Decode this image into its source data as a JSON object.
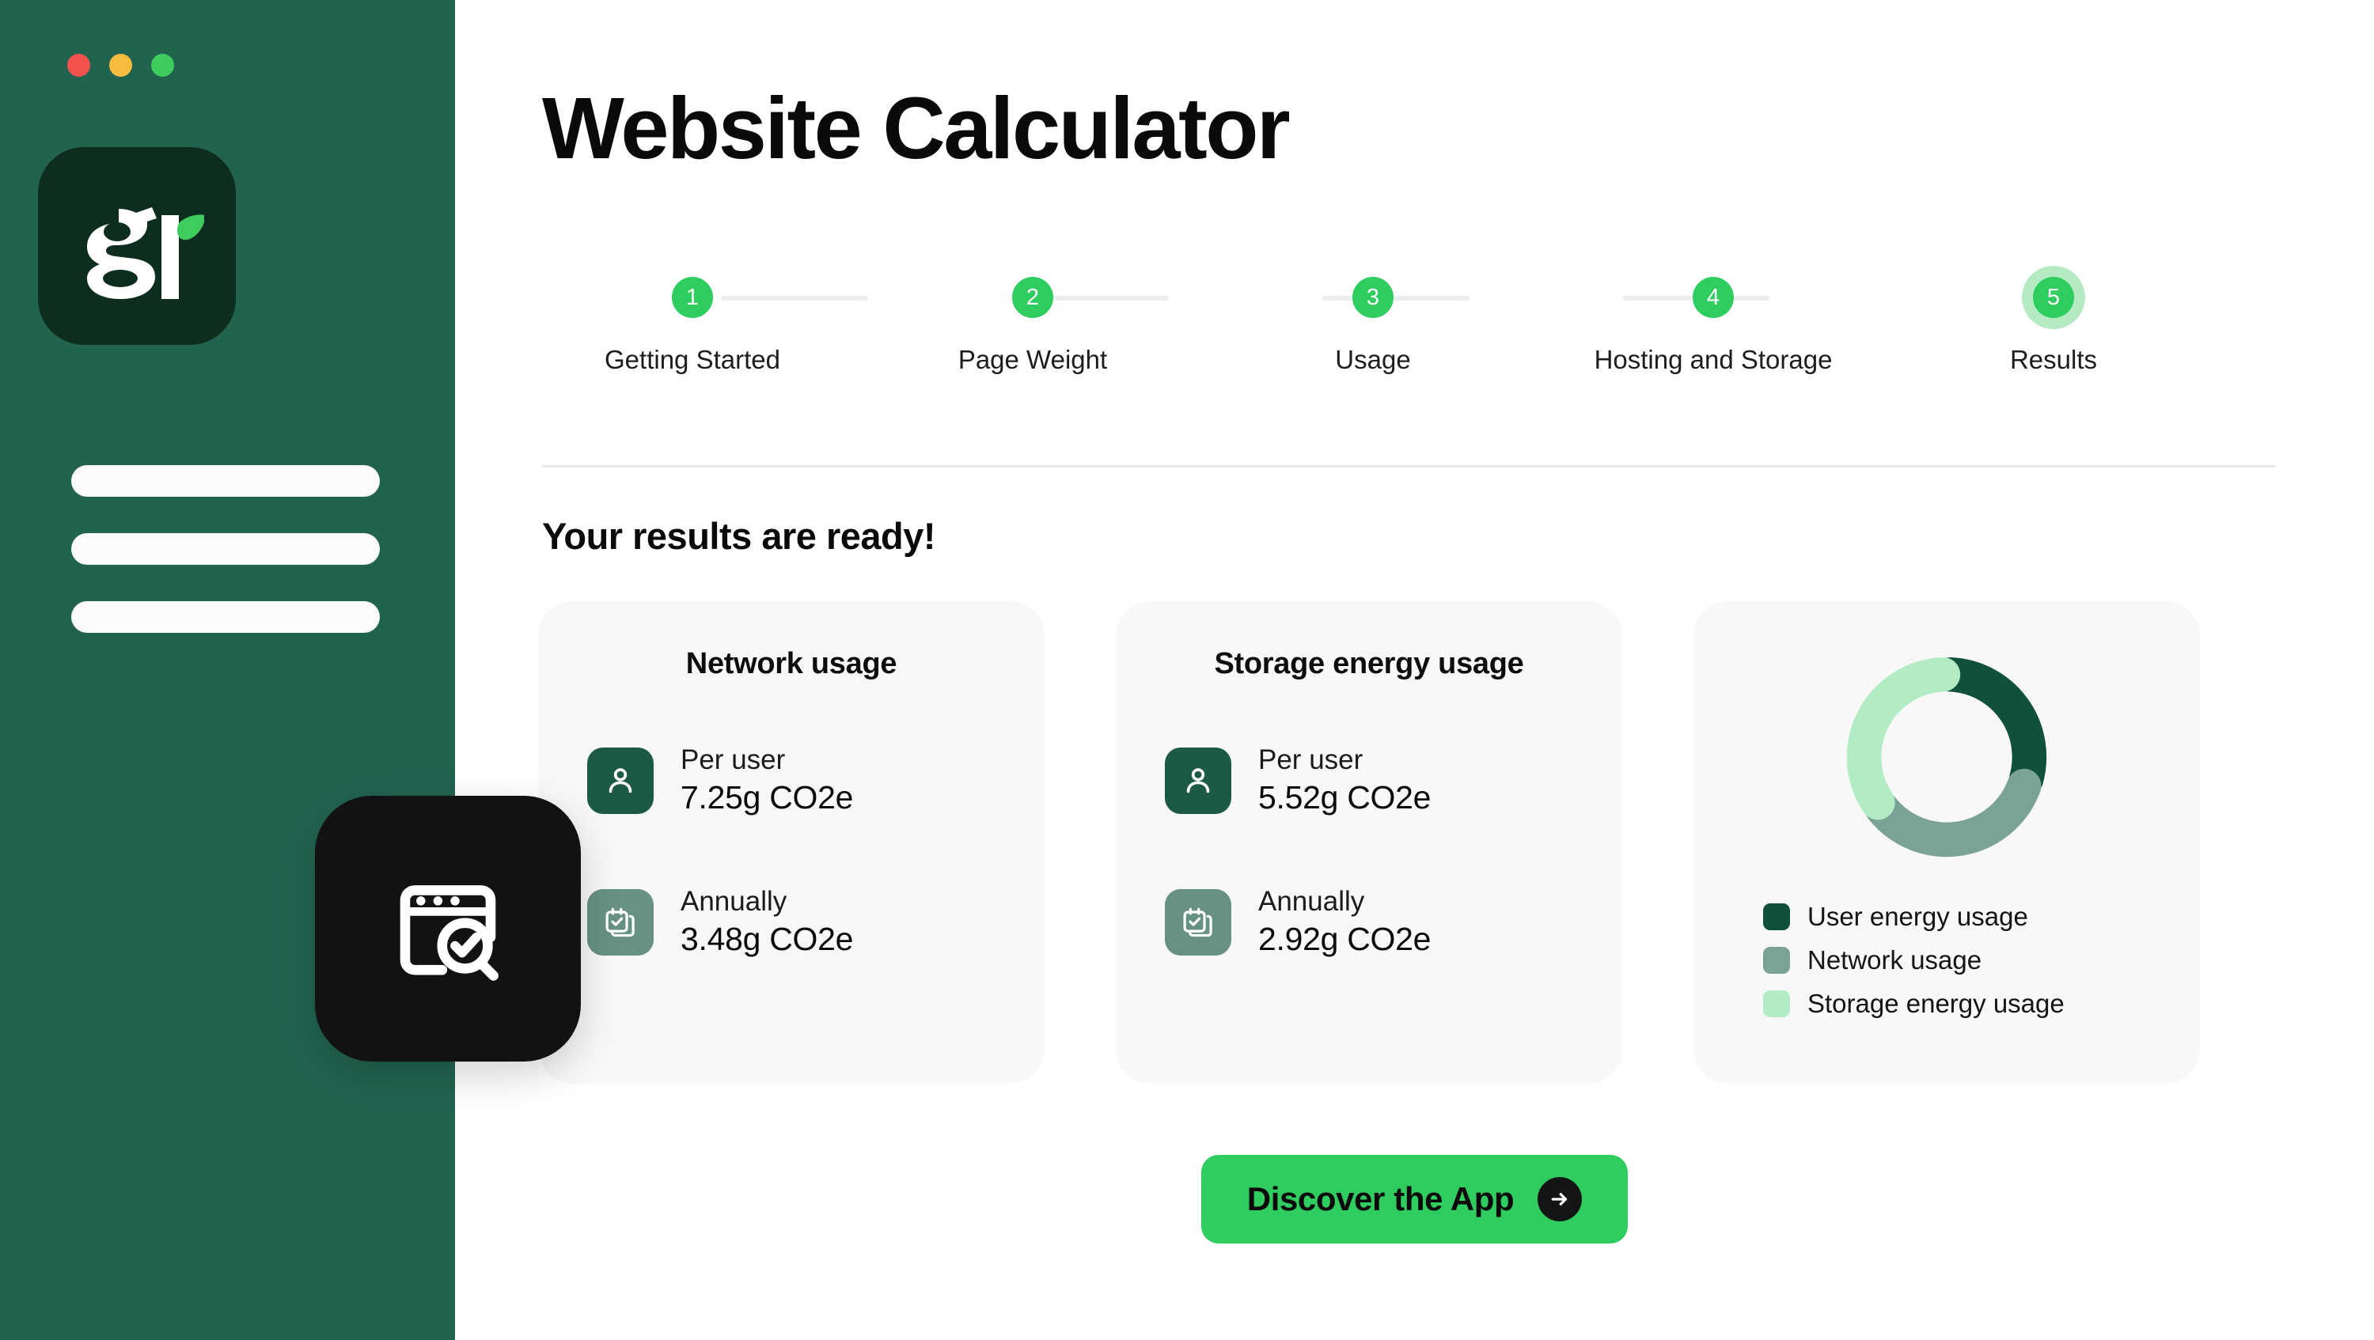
{
  "window": {
    "traffic_lights": [
      "close",
      "minimize",
      "maximize"
    ]
  },
  "sidebar": {
    "logo_alt": "gr",
    "nav_placeholder_count": 3,
    "app_icon_alt": "website-audit-icon",
    "background_color": "#226350",
    "logo_tile_color": "#0d2e1f",
    "app_icon_color": "#121212"
  },
  "header": {
    "title": "Website Calculator"
  },
  "stepper": {
    "steps": [
      {
        "number": "1",
        "label": "Getting Started",
        "active": false
      },
      {
        "number": "2",
        "label": "Page Weight",
        "active": false
      },
      {
        "number": "3",
        "label": "Usage",
        "active": false
      },
      {
        "number": "4",
        "label": "Hosting and Storage",
        "active": false
      },
      {
        "number": "5",
        "label": "Results",
        "active": true
      }
    ],
    "accent_color": "#2fcc5f",
    "active_halo_color": "#b4ebc3",
    "connector_color": "#eceff0"
  },
  "results": {
    "heading": "Your results are ready!",
    "cards": [
      {
        "title": "Network usage",
        "metrics": [
          {
            "icon": "person-icon",
            "label": "Per user",
            "value": "7.25g CO2e",
            "icon_color": "#1d5a43"
          },
          {
            "icon": "calendar-check-icon",
            "label": "Annually",
            "value": "3.48g CO2e",
            "icon_color": "#679183"
          }
        ]
      },
      {
        "title": "Storage energy usage",
        "metrics": [
          {
            "icon": "person-icon",
            "label": "Per user",
            "value": "5.52g CO2e",
            "icon_color": "#1d5a43"
          },
          {
            "icon": "calendar-check-icon",
            "label": "Annually",
            "value": "2.92g CO2e",
            "icon_color": "#679183"
          }
        ]
      }
    ]
  },
  "chart_data": {
    "type": "pie",
    "title": "",
    "variant": "donut",
    "legend_position": "bottom-left",
    "categories": [
      "User energy usage",
      "Network usage",
      "Storage energy usage"
    ],
    "values": [
      30,
      35,
      35
    ],
    "colors": [
      "#11503b",
      "#7ba395",
      "#b3ecc4"
    ],
    "segments": [
      {
        "name": "User energy usage",
        "value": 30,
        "color": "#11503b",
        "start_deg": 0,
        "end_deg": 108
      },
      {
        "name": "Network usage",
        "value": 35,
        "color": "#7ba395",
        "start_deg": 108,
        "end_deg": 234
      },
      {
        "name": "Storage energy usage",
        "value": 35,
        "color": "#b3ecc4",
        "start_deg": 234,
        "end_deg": 360
      }
    ]
  },
  "cta": {
    "label": "Discover the App",
    "icon": "arrow-right-icon",
    "background_color": "#2fcc5f",
    "arrow_badge_color": "#151515"
  }
}
